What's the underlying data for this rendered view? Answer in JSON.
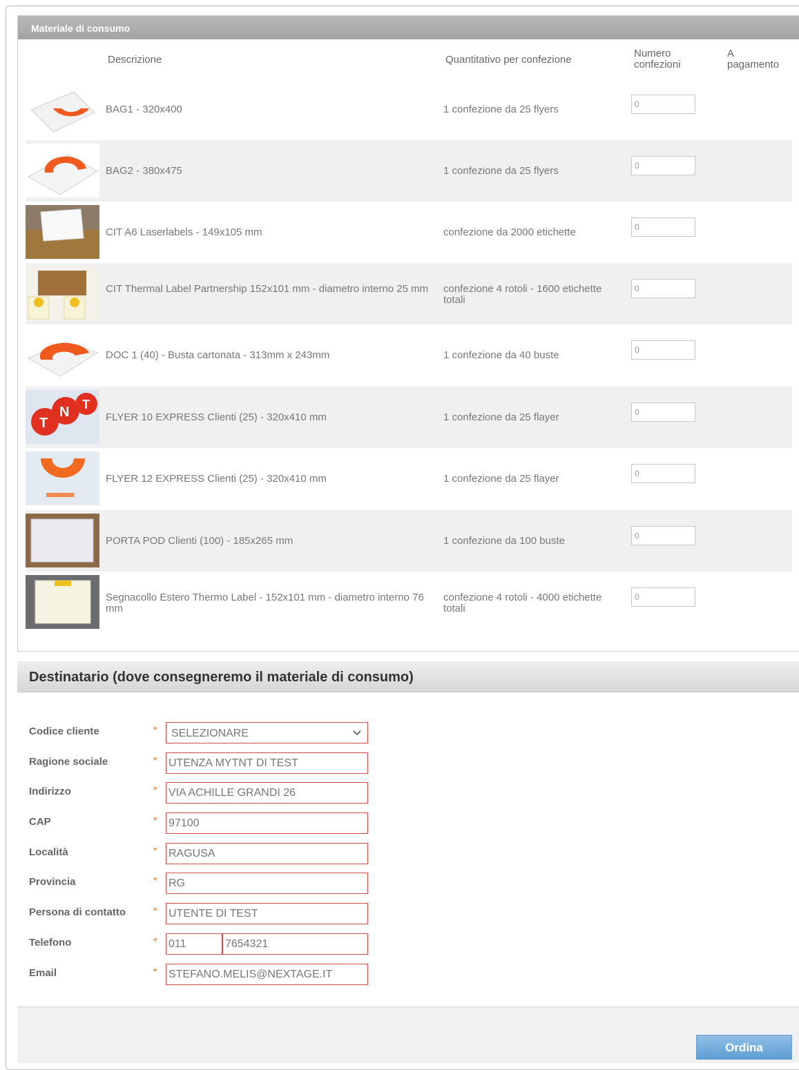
{
  "consumables": {
    "title": "Materiale di consumo",
    "headers": {
      "description": "Descrizione",
      "quantity": "Quantitativo per confezione",
      "num_packs_line1": "Numero",
      "num_packs_line2": "confezioni",
      "paid_line1": "A",
      "paid_line2": "pagamento"
    },
    "items": [
      {
        "description": "BAG1 - 320x400",
        "quantity": "1 confezione da 25 flyers",
        "count": "0",
        "image": "orange-bag-icon"
      },
      {
        "description": "BAG2 - 380x475",
        "quantity": "1 confezione da 25 flyers",
        "count": "0",
        "image": "orange-bag-icon"
      },
      {
        "description": "CIT A6 Laserlabels - 149x105 mm",
        "quantity": "confezione da 2000 etichette",
        "count": "0",
        "image": "label-box-icon"
      },
      {
        "description": "CIT Thermal Label Partnership 152x101 mm - diametro interno 25 mm",
        "quantity": "confezione 4 rotoli - 1600 etichette totali",
        "count": "0",
        "image": "label-rolls-icon"
      },
      {
        "description": "DOC 1 (40) - Busta cartonata - 313mm x 243mm",
        "quantity": "1 confezione da 40 buste",
        "count": "0",
        "image": "envelope-icon"
      },
      {
        "description": "FLYER 10 EXPRESS Clienti (25) - 320x410 mm",
        "quantity": "1 confezione da 25 flayer",
        "count": "0",
        "image": "tnt-flyer-icon"
      },
      {
        "description": "FLYER 12 EXPRESS Clienti (25) - 320x410 mm",
        "quantity": "1 confezione da 25 flayer",
        "count": "0",
        "image": "express-flyer-icon"
      },
      {
        "description": "PORTA POD Clienti (100) - 185x265 mm",
        "quantity": "1 confezione da 100 buste",
        "count": "0",
        "image": "pod-pouch-icon"
      },
      {
        "description": "Segnacollo Estero Thermo Label - 152x101 mm - diametro interno 76 mm",
        "quantity": "confezione 4 rotoli - 4000 etichette totali",
        "count": "0",
        "image": "label-roll-icon"
      }
    ]
  },
  "recipient": {
    "title": "Destinatario (dove consegneremo il materiale di consumo)",
    "required_mark": "*",
    "fields": {
      "codice_cliente": {
        "label": "Codice cliente",
        "value": "SELEZIONARE"
      },
      "ragione_sociale": {
        "label": "Ragione sociale",
        "value": "UTENZA MYTNT DI TEST"
      },
      "indirizzo": {
        "label": "Indirizzo",
        "value": "VIA ACHILLE GRANDI 26"
      },
      "cap": {
        "label": "CAP",
        "value": "97100"
      },
      "localita": {
        "label": "Località",
        "value": "RAGUSA"
      },
      "provincia": {
        "label": "Provincia",
        "value": "RG"
      },
      "contatto": {
        "label": "Persona di contatto",
        "value": "UTENTE DI TEST"
      },
      "telefono": {
        "label": "Telefono",
        "prefix": "011",
        "number": "7654321"
      },
      "email": {
        "label": "Email",
        "value": "STEFANO.MELIS@NEXTAGE.IT"
      }
    }
  },
  "actions": {
    "order": "Ordina"
  },
  "colors": {
    "accent": "#f07020",
    "error_border": "#d24a4a",
    "button": "#6fa9da"
  }
}
